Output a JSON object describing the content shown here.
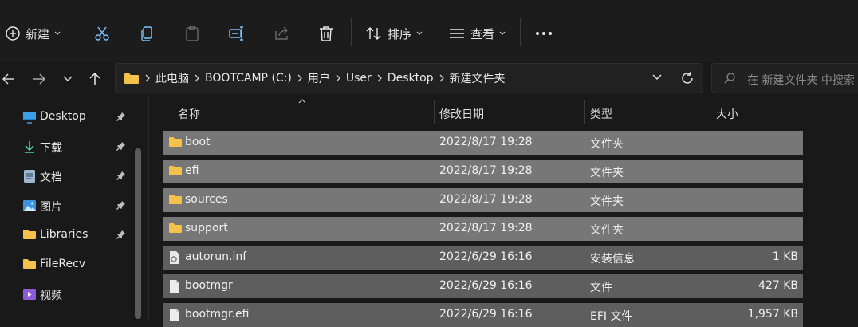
{
  "toolbar": {
    "new_label": "新建",
    "sort_label": "排序",
    "view_label": "查看"
  },
  "address": {
    "crumbs": [
      "此电脑",
      "BOOTCAMP (C:)",
      "用户",
      "User",
      "Desktop",
      "新建文件夹"
    ]
  },
  "search": {
    "placeholder": "在 新建文件夹 中搜索"
  },
  "sidebar": {
    "items": [
      {
        "label": "Desktop",
        "icon": "desktop-icon",
        "pinned": true
      },
      {
        "label": "下载",
        "icon": "download-icon",
        "pinned": true
      },
      {
        "label": "文档",
        "icon": "document-icon",
        "pinned": true
      },
      {
        "label": "图片",
        "icon": "pictures-icon",
        "pinned": true
      },
      {
        "label": "Libraries",
        "icon": "folder-icon",
        "pinned": true
      },
      {
        "label": "FileRecv",
        "icon": "folder-icon",
        "pinned": false
      },
      {
        "label": "视频",
        "icon": "video-icon",
        "pinned": false
      }
    ]
  },
  "columns": {
    "name": "名称",
    "modified": "修改日期",
    "type": "类型",
    "size": "大小"
  },
  "files": [
    {
      "name": "boot",
      "modified": "2022/8/17 19:28",
      "type": "文件夹",
      "size": "",
      "icon": "folder-icon"
    },
    {
      "name": "efi",
      "modified": "2022/8/17 19:28",
      "type": "文件夹",
      "size": "",
      "icon": "folder-icon"
    },
    {
      "name": "sources",
      "modified": "2022/8/17 19:28",
      "type": "文件夹",
      "size": "",
      "icon": "folder-icon"
    },
    {
      "name": "support",
      "modified": "2022/8/17 19:28",
      "type": "文件夹",
      "size": "",
      "icon": "folder-icon"
    },
    {
      "name": "autorun.inf",
      "modified": "2022/6/29 16:16",
      "type": "安装信息",
      "size": "1 KB",
      "icon": "setup-info-file-icon"
    },
    {
      "name": "bootmgr",
      "modified": "2022/6/29 16:16",
      "type": "文件",
      "size": "427 KB",
      "icon": "file-icon"
    },
    {
      "name": "bootmgr.efi",
      "modified": "2022/6/29 16:16",
      "type": "EFI 文件",
      "size": "1,957 KB",
      "icon": "file-icon"
    }
  ],
  "colors": {
    "folder": "#f4c24a",
    "accent": "#4cc2ff"
  }
}
